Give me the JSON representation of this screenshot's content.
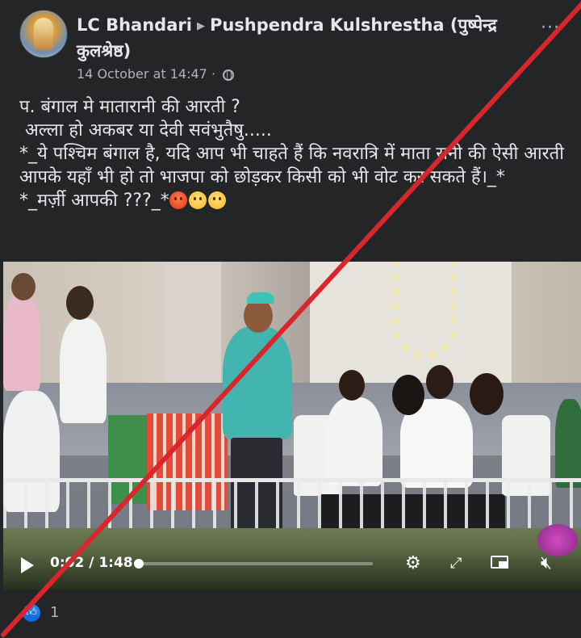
{
  "header": {
    "author": "LC Bhandari",
    "target": "Pushpendra Kulshrestha (पुष्पेन्द्र कुलश्रेष्ठ)",
    "timestamp": "14 October at 14:47",
    "privacy_icon": "globe-icon",
    "more_label": "···"
  },
  "post": {
    "line1": "प. बंगाल मे मातारानी की आरती ?",
    "line2": " अल्ला हो अकबर या देवी सवंभुतैषु.....",
    "line3": "*_ये पश्चिम बंगाल है, यदि आप भी चाहते हैं कि नवरात्रि में माता रानी की ऐसी आरती आपके यहाँ भी हो तो भाजपा को छोड़कर किसी को भी वोट कर सकते हैं।_*",
    "line4": "*_मर्ज़ी आपकी ???_*",
    "emojis": [
      "angry-face-icon",
      "dizzy-face-icon",
      "frowning-face-icon"
    ]
  },
  "video": {
    "time_display": "0:02 / 1:48",
    "progress_fraction": 0.019,
    "controls": [
      "play-icon",
      "settings-gear-icon",
      "expand-icon",
      "picture-in-picture-icon",
      "mute-icon"
    ]
  },
  "reactions": {
    "like_icon": "thumbs-up-icon",
    "count": "1"
  },
  "colors": {
    "background": "#242526",
    "text": "#e4e6eb",
    "secondary": "#b0b3b8",
    "strike": "#d9262c",
    "like": "#1877f2"
  }
}
